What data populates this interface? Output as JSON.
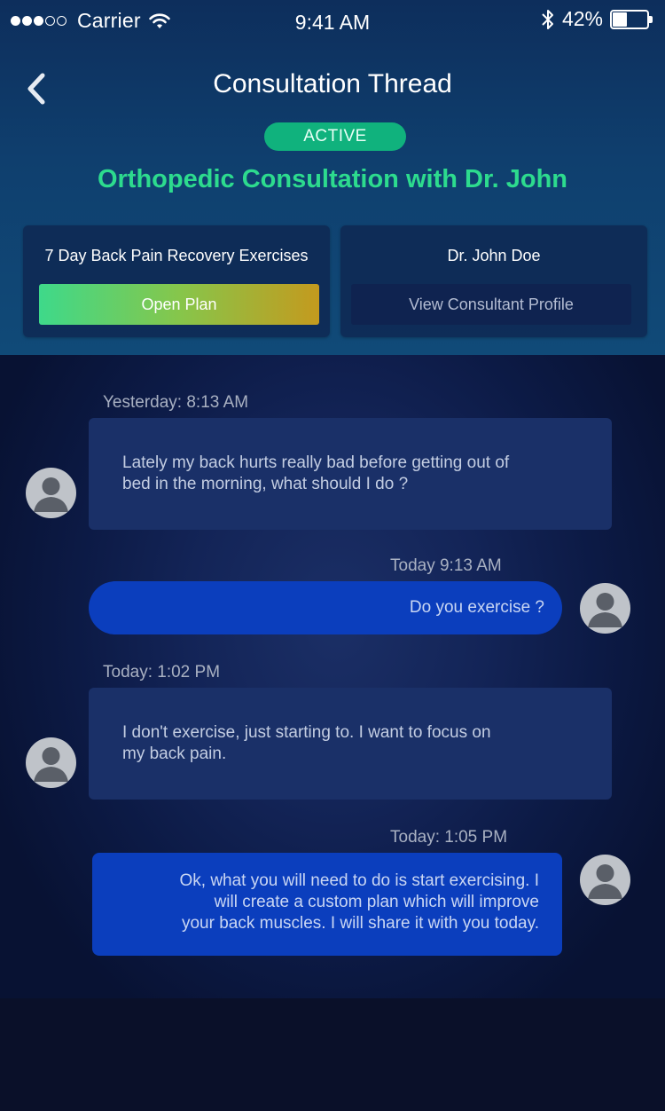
{
  "status_bar": {
    "carrier": "Carrier",
    "time": "9:41 AM",
    "battery_percent_label": "42%",
    "battery_level": 0.42
  },
  "header": {
    "title": "Consultation Thread",
    "status_badge": "ACTIVE",
    "subject": "Orthopedic Consultation with Dr. John"
  },
  "plan_card": {
    "label": "7 Day Back Pain Recovery Exercises",
    "button": "Open Plan"
  },
  "consultant_card": {
    "label": "Dr. John Doe",
    "button": "View Consultant Profile"
  },
  "messages": [
    {
      "timestamp": "Yesterday: 8:13 AM",
      "direction": "incoming",
      "line1": "Lately my back hurts really bad before getting out of",
      "line2": "bed in the morning, what should I do ?"
    },
    {
      "timestamp": "Today 9:13 AM",
      "direction": "outgoing",
      "line1": "Do you exercise ?"
    },
    {
      "timestamp": "Today: 1:02 PM",
      "direction": "incoming",
      "line1": "I don't exercise, just starting to. I want to focus on",
      "line2": "my back pain."
    },
    {
      "timestamp": "Today: 1:05 PM",
      "direction": "outgoing",
      "line1": "Ok, what you will need to do is start exercising.  I",
      "line2": "will create a custom plan which will improve",
      "line3": "your back muscles. I will share it with you today."
    }
  ],
  "colors": {
    "accent_green": "#2ddb8e",
    "badge_green": "#10b27d",
    "outgoing_bubble": "#0b3ebd",
    "incoming_bubble": "#1a3068"
  },
  "icons": [
    "back-chevron-icon",
    "wifi-icon",
    "bluetooth-icon",
    "battery-icon",
    "avatar-placeholder-icon"
  ]
}
